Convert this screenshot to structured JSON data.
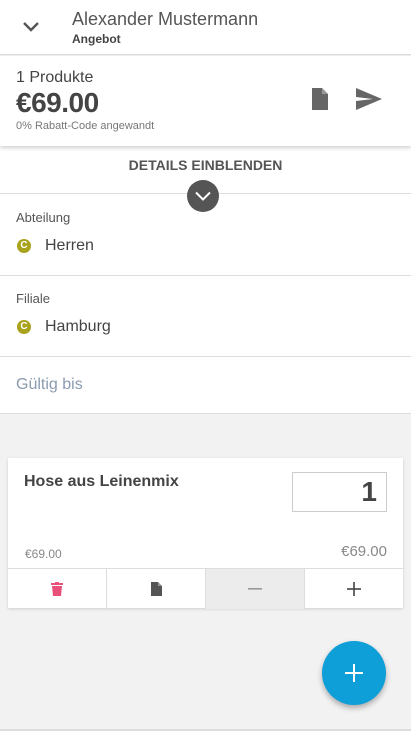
{
  "header": {
    "customer_name": "Alexander Mustermann",
    "document_type": "Angebot"
  },
  "summary": {
    "product_count": "1 Produkte",
    "total_price": "€69.00",
    "discount_note": "0% Rabatt-Code angewandt"
  },
  "details": {
    "toggle_label": "DETAILS EINBLENDEN",
    "fields": [
      {
        "label": "Abteilung",
        "value": "Herren",
        "badge": "C"
      },
      {
        "label": "Filiale",
        "value": "Hamburg",
        "badge": "C"
      }
    ],
    "valid_until_placeholder": "Gültig bis"
  },
  "line_item": {
    "product_name": "Hose aus Leinenmix",
    "quantity": "1",
    "unit_price": "€69.00",
    "line_total": "€69.00",
    "actions": [
      "trash-icon",
      "document-icon",
      "minus-icon",
      "plus-icon"
    ]
  },
  "colors": {
    "accent": "#0e9ed8",
    "badge": "#a8a21c",
    "delete": "#e8507a",
    "text_dark": "#444444"
  },
  "icons": {
    "back": "chevron-down-icon",
    "document": "document-icon",
    "send": "send-icon",
    "expand": "chevron-down-icon",
    "fab": "plus-icon"
  }
}
